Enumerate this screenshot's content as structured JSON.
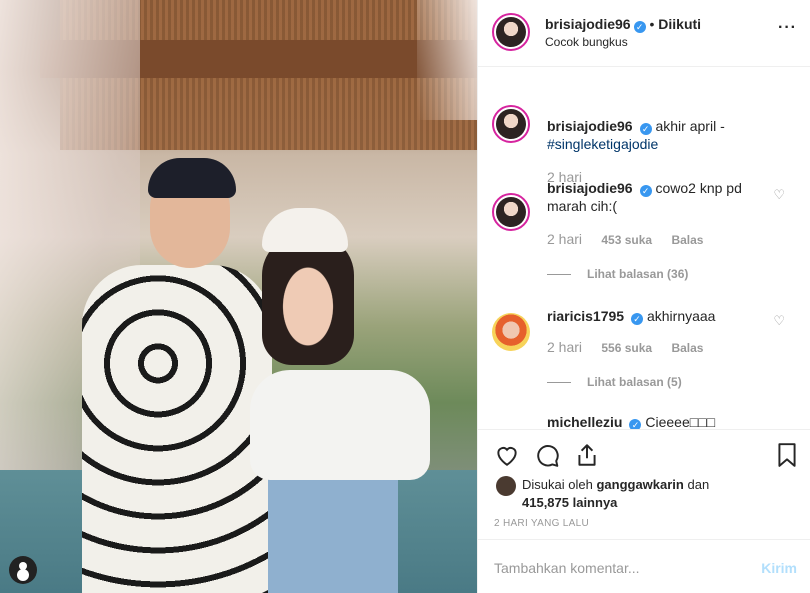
{
  "post": {
    "username": "brisiajodie96",
    "follow_status": "Diikuti",
    "location": "Cocok bungkus",
    "more_icon": "more-dots-icon"
  },
  "comments": [
    {
      "username": "brisiajodie96",
      "text": "akhir april -",
      "tag": "#singleketigajodie",
      "time": "2 hari",
      "likes": "",
      "reply": "",
      "view_replies": ""
    },
    {
      "username": "brisiajodie96",
      "text": "cowo2 knp pd marah cih:(",
      "time": "2 hari",
      "likes": "453 suka",
      "reply": "Balas",
      "view_replies": "Lihat balasan (36)"
    },
    {
      "username": "riaricis1795",
      "text": "akhirnyaaa",
      "time": "2 hari",
      "likes": "556 suka",
      "reply": "Balas",
      "view_replies": "Lihat balasan (5)"
    },
    {
      "username": "michelleziu",
      "text": "Cieeee□□□"
    }
  ],
  "actions": {
    "liked_by_prefix": "Disukai oleh",
    "liked_by_user": "ganggawkarin",
    "liked_by_conj": "dan",
    "liked_count": "415,875 lainnya",
    "time_ago": "2 HARI YANG LALU"
  },
  "add_comment": {
    "placeholder": "Tambahkan komentar...",
    "send": "Kirim"
  },
  "colors": {
    "verified": "#3897f0",
    "link": "#003569",
    "muted": "#999999",
    "send_disabled": "#b2dffc"
  }
}
